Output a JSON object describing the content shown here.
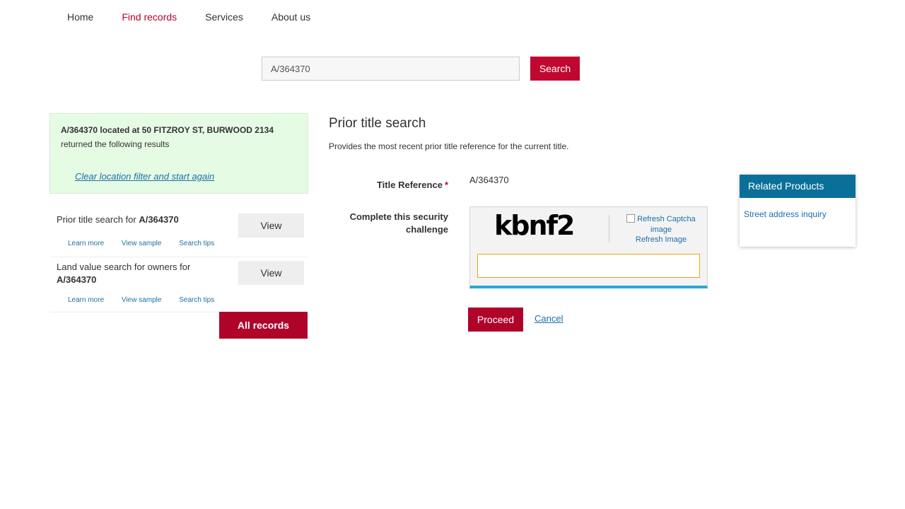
{
  "nav": {
    "items": [
      {
        "label": "Home"
      },
      {
        "label": "Find records"
      },
      {
        "label": "Services"
      },
      {
        "label": "About us"
      }
    ]
  },
  "search": {
    "value": "A/364370",
    "button_label": "Search"
  },
  "location_box": {
    "location_text": "A/364370 located at 50 FITZROY ST, BURWOOD 2134",
    "returned_text": "returned the following results",
    "clear_link": "Clear location filter and start again"
  },
  "results": [
    {
      "title_prefix": "Prior title search for ",
      "title_ref": "A/364370",
      "view_label": "View",
      "links": [
        "Learn more",
        "View sample",
        "Search tips"
      ]
    },
    {
      "title_prefix": "Land value search for owners for ",
      "title_ref": "A/364370",
      "view_label": "View",
      "links": [
        "Learn more",
        "View sample",
        "Search tips"
      ]
    }
  ],
  "all_records_label": "All records",
  "form": {
    "heading": "Prior title search",
    "description": "Provides the most recent prior title reference for the current title.",
    "title_ref_label": "Title Reference",
    "required_mark": "*",
    "title_ref_value": "A/364370",
    "security_label": "Complete this security challenge",
    "captcha_text": "kbnf2",
    "captcha_alt": "Refresh Captcha image",
    "refresh_label": "Refresh Image",
    "captcha_input_value": "",
    "proceed_label": "Proceed",
    "cancel_label": "Cancel"
  },
  "related": {
    "title": "Related Products",
    "link": "Street address inquiry"
  },
  "colors": {
    "brand_red": "#c0072f",
    "related_header": "#0a7099",
    "green_box": "#e5fbe4",
    "link_blue": "#1d6fa8"
  }
}
